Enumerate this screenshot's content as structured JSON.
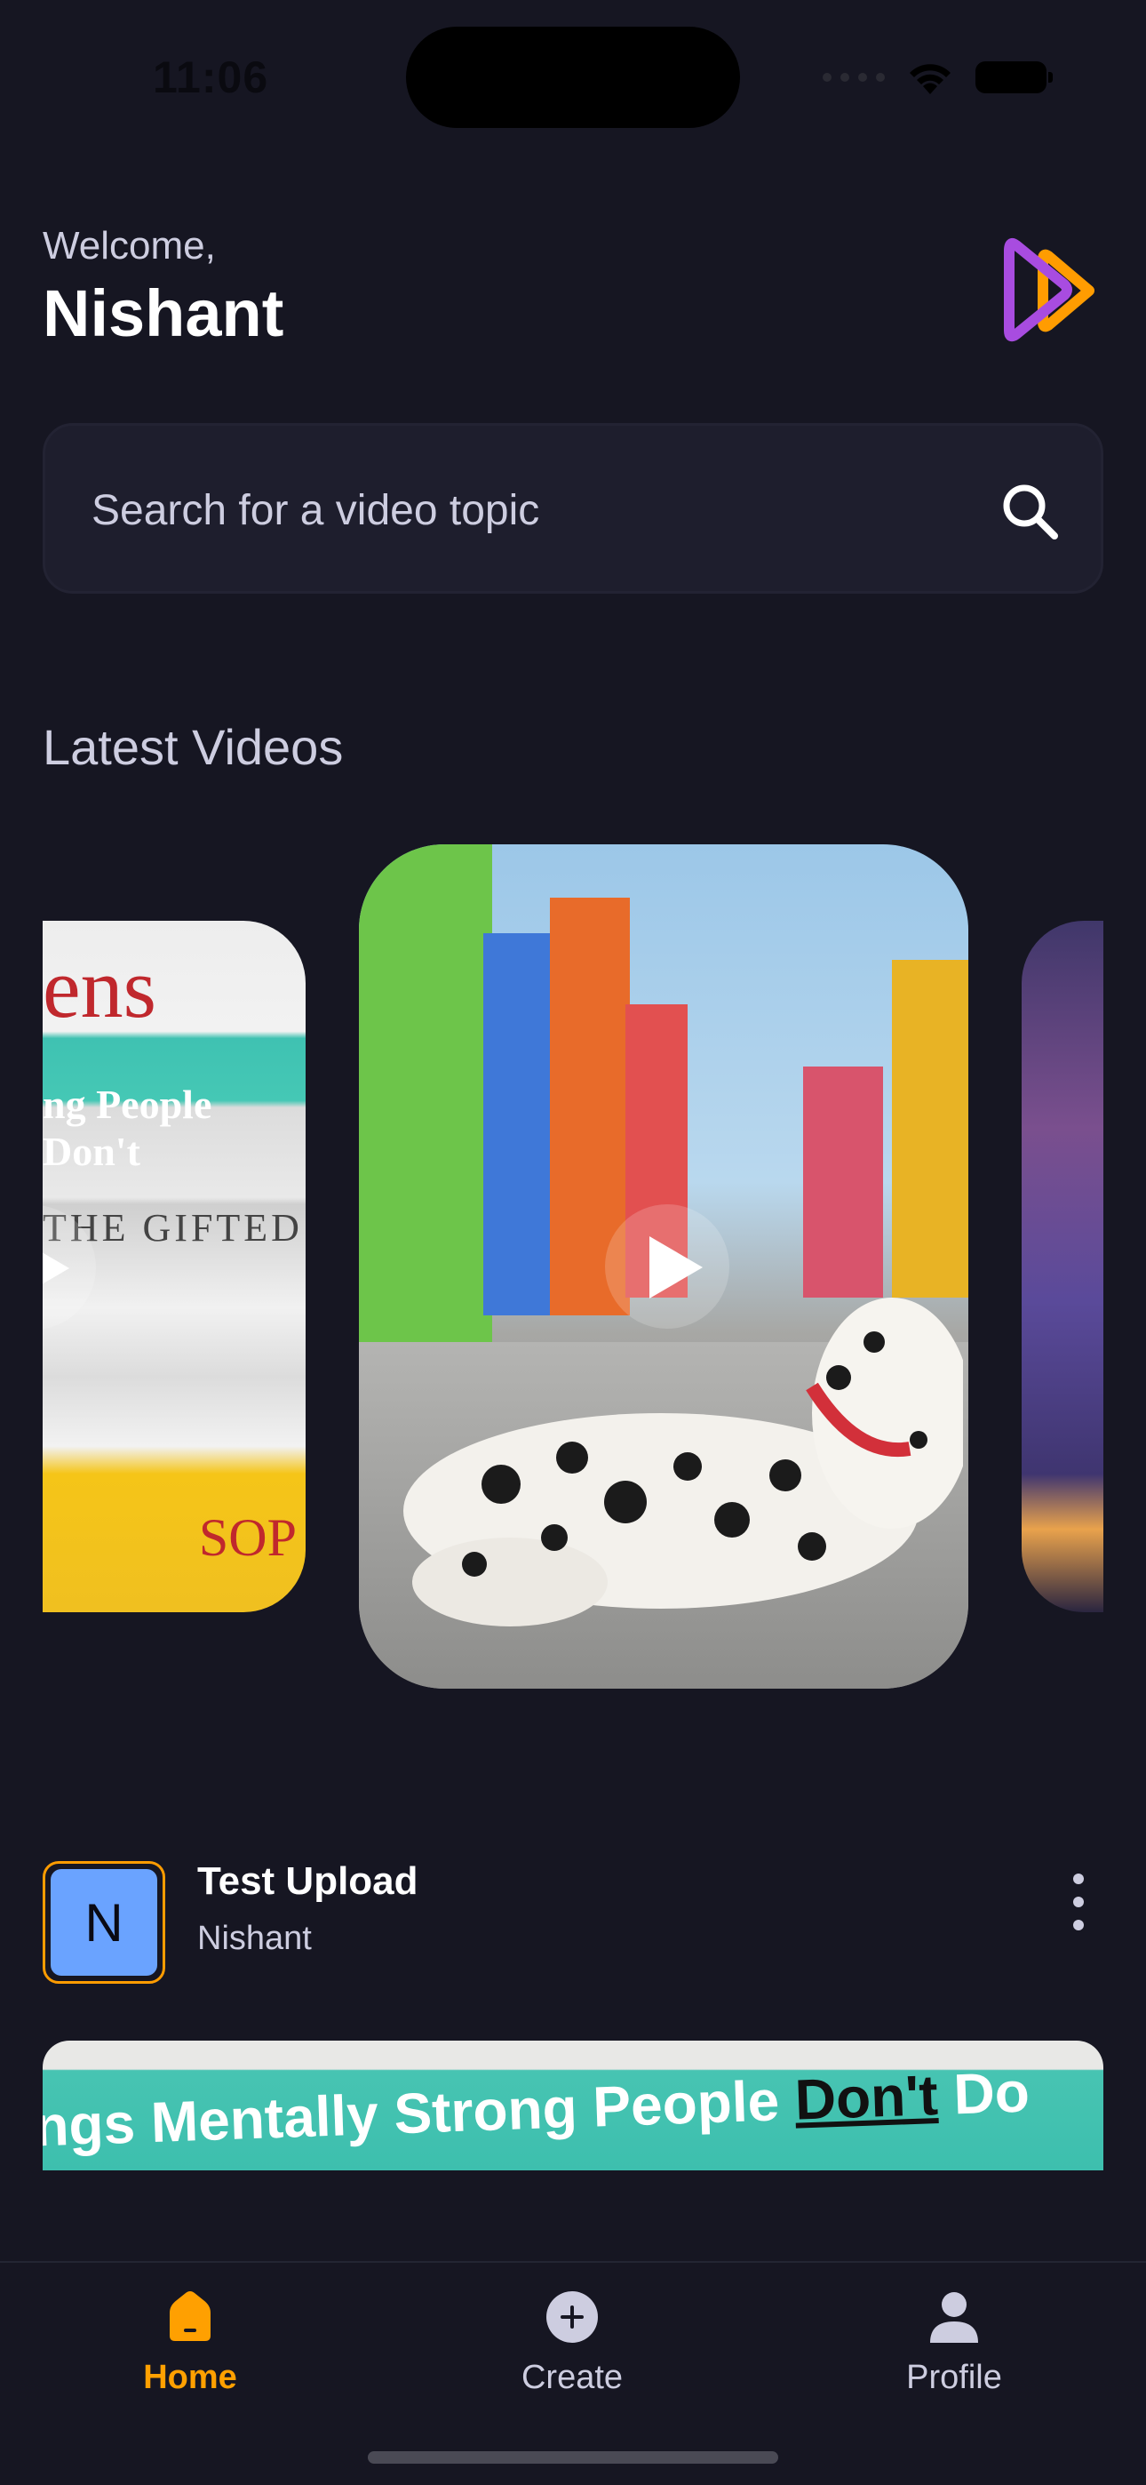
{
  "status_bar": {
    "time": "11:06"
  },
  "header": {
    "greeting": "Welcome,",
    "username": "Nishant"
  },
  "search": {
    "placeholder": "Search for a video topic"
  },
  "latest": {
    "title": "Latest Videos",
    "book_spines": [
      "ens",
      "ng People Don't",
      "THE GIFTED",
      "SOP"
    ]
  },
  "post": {
    "title": "Test Upload",
    "author": "Nishant",
    "avatar_letter": "N",
    "thumbnail_text_prefix": "ngs Mentally Strong People ",
    "thumbnail_text_underline": "Don't",
    "thumbnail_text_suffix": " Do"
  },
  "tabs": [
    {
      "label": "Home",
      "icon": "home-icon",
      "active": true
    },
    {
      "label": "Create",
      "icon": "plus-icon",
      "active": false
    },
    {
      "label": "Profile",
      "icon": "profile-icon",
      "active": false
    }
  ],
  "colors": {
    "background": "#161622",
    "accent": "#ffa001",
    "card": "#1e1e2d",
    "secondary_text": "#cdcde0"
  }
}
